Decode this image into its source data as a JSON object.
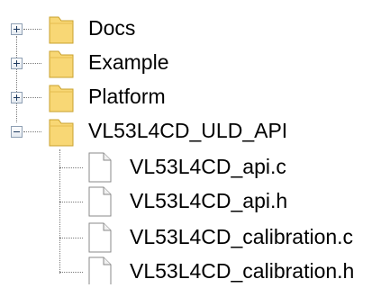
{
  "tree": {
    "folders": [
      {
        "label": "Docs",
        "expander": "plus",
        "icon": "folder-icon"
      },
      {
        "label": "Example",
        "expander": "plus",
        "icon": "folder-icon"
      },
      {
        "label": "Platform",
        "expander": "plus",
        "icon": "folder-icon"
      },
      {
        "label": "VL53L4CD_ULD_API",
        "expander": "minus",
        "icon": "folder-icon"
      }
    ],
    "files": [
      {
        "label": "VL53L4CD_api.c",
        "icon": "file-icon"
      },
      {
        "label": "VL53L4CD_api.h",
        "icon": "file-icon"
      },
      {
        "label": "VL53L4CD_calibration.c",
        "icon": "file-icon"
      },
      {
        "label": "VL53L4CD_calibration.h",
        "icon": "file-icon"
      }
    ]
  },
  "colors": {
    "folder_fill": "#f8d775",
    "folder_stroke": "#c9a12d",
    "file_fill": "#ffffff",
    "file_stroke": "#8a8a8a",
    "expander_border": "#8e9fb3",
    "connector": "#7a7a7a"
  }
}
